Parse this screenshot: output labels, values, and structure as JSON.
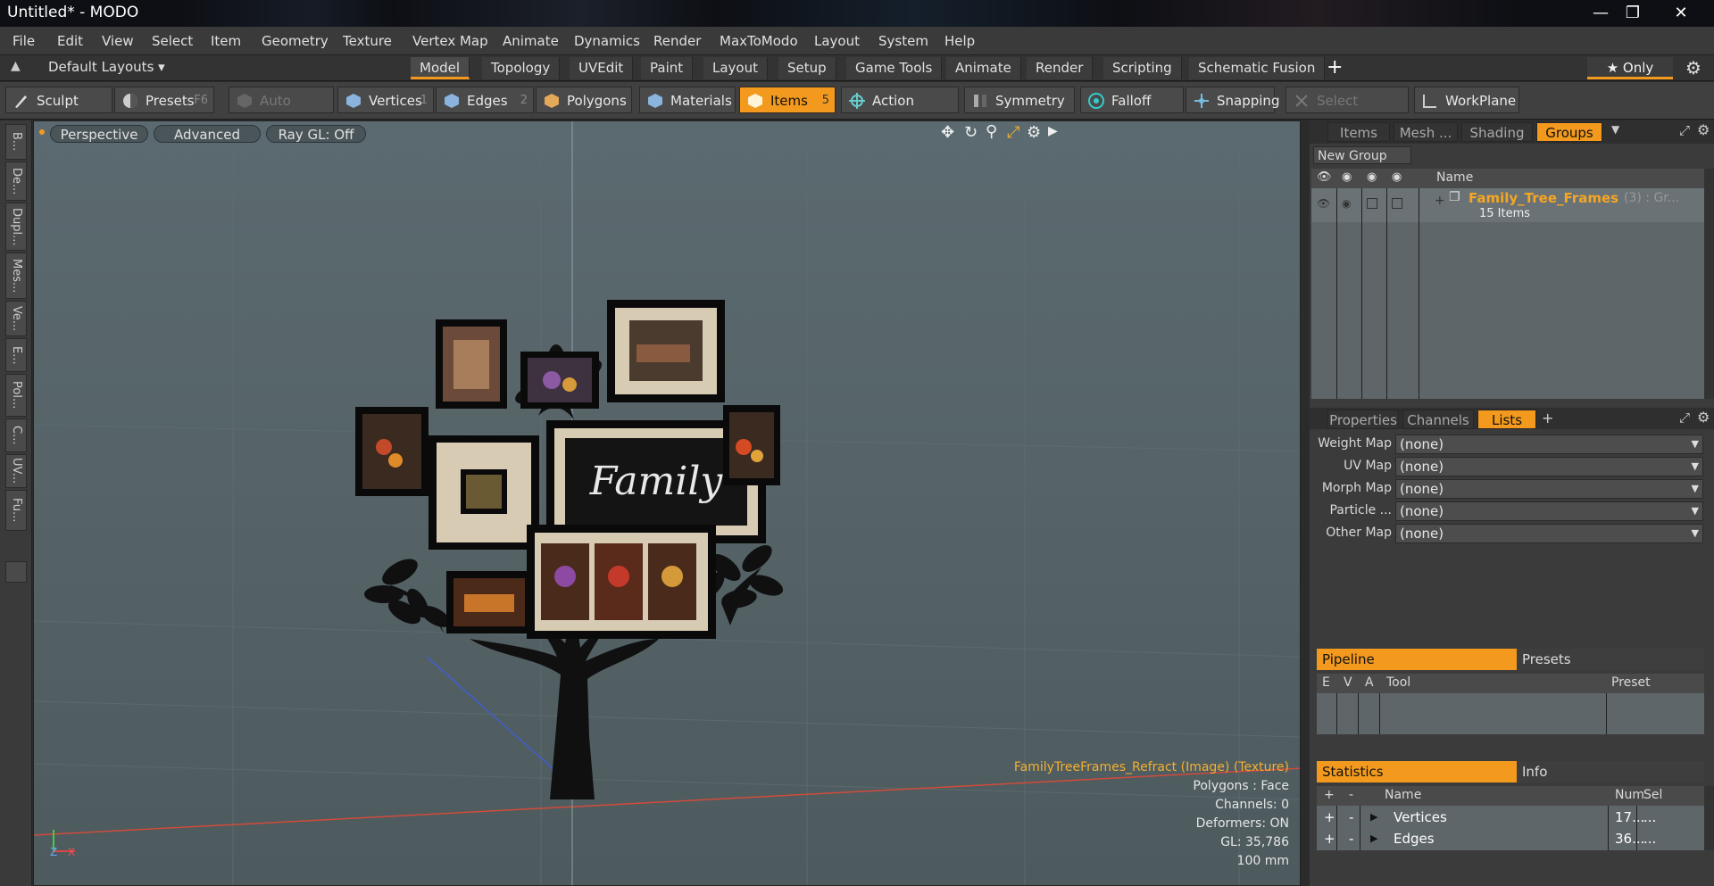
{
  "window": {
    "title": "Untitled* - MODO"
  },
  "menu": [
    "File",
    "Edit",
    "View",
    "Select",
    "Item",
    "Geometry",
    "Texture",
    "Vertex Map",
    "Animate",
    "Dynamics",
    "Render",
    "MaxToModo",
    "Layout",
    "System",
    "Help"
  ],
  "layout_bar": {
    "default_layouts": "Default Layouts ▾",
    "tabs": [
      "Model",
      "Topology",
      "UVEdit",
      "Paint",
      "Layout",
      "Setup",
      "Game Tools",
      "Animate",
      "Render",
      "Scripting",
      "Schematic Fusion"
    ],
    "active_tab": "Model",
    "plus": "+",
    "only_label": "★ Only"
  },
  "toolbar": {
    "sculpt": "Sculpt",
    "presets": "Presets",
    "presets_key": "F6",
    "auto_select": "Auto Select",
    "vertices": "Vertices",
    "vertices_key": "1",
    "edges": "Edges",
    "edges_key": "2",
    "polygons": "Polygons",
    "materials": "Materials",
    "items": "Items",
    "items_key": "5",
    "action_center": "Action Center",
    "symmetry": "Symmetry",
    "falloff": "Falloff",
    "snapping": "Snapping",
    "select_through": "Select Through",
    "workplane": "WorkPlane"
  },
  "left_tabs": [
    "B...",
    "De...",
    "Dupl...",
    "Mes...",
    "Ve...",
    "E...",
    "Pol...",
    "C...",
    "UV...",
    "Fu..."
  ],
  "viewport": {
    "perspective": "Perspective",
    "advanced": "Advanced",
    "raygl": "Ray GL: Off",
    "art_text": "Family",
    "info": {
      "texture": "FamilyTreeFrames_Refract (Image) (Texture)",
      "polygons": "Polygons : Face",
      "channels": "Channels: 0",
      "deformers": "Deformers: ON",
      "gl": "GL: 35,786",
      "scale": "100 mm"
    },
    "axis_z": "Z",
    "axis_x": "X"
  },
  "items_panel": {
    "tabs": [
      "Items",
      "Mesh ...",
      "Shading",
      "Groups"
    ],
    "active_tab": "Groups",
    "new_group": "New Group",
    "col_name": "Name",
    "group_name": "Family_Tree_Frames",
    "group_suffix": "(3) : Gr...",
    "group_count": "15 Items"
  },
  "props_panel": {
    "tabs": [
      "Properties",
      "Channels",
      "Lists"
    ],
    "active_tab": "Lists",
    "plus": "+",
    "maps": [
      {
        "label": "Weight Map",
        "value": "(none)"
      },
      {
        "label": "UV Map",
        "value": "(none)"
      },
      {
        "label": "Morph Map",
        "value": "(none)"
      },
      {
        "label": "Particle ...",
        "value": "(none)"
      },
      {
        "label": "Other Map",
        "value": "(none)"
      }
    ],
    "pipeline": "Pipeline",
    "presets": "Presets",
    "pipe_cols": [
      "E",
      "V",
      "A",
      "Tool",
      "Preset"
    ],
    "statistics": "Statistics",
    "info": "Info",
    "stat_cols": [
      "+",
      "-",
      "Name",
      "Num",
      "Sel"
    ],
    "stat_rows": [
      {
        "plus": "+",
        "minus": "-",
        "name": "Vertices",
        "num": "17...",
        "sel": "..."
      },
      {
        "plus": "+",
        "minus": "-",
        "name": "Edges",
        "num": "36...",
        "sel": "..."
      }
    ]
  },
  "colors": {
    "accent": "#f39a1e",
    "viewport_bg": "#566468",
    "group_text": "#f5a623"
  }
}
